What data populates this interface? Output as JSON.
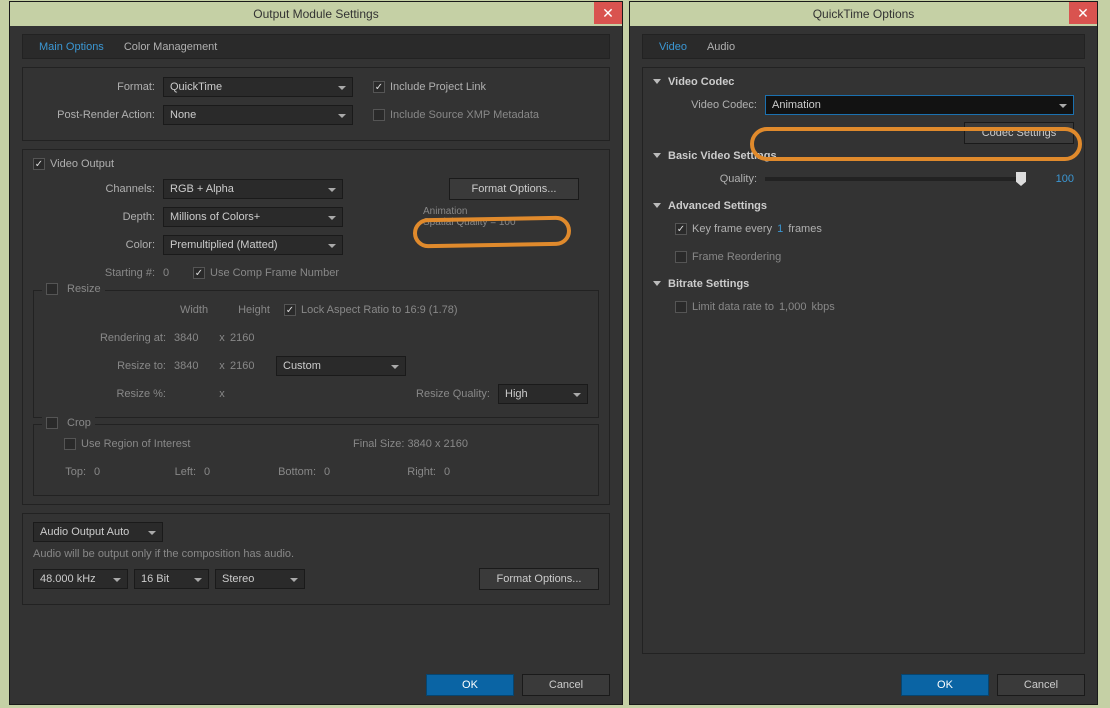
{
  "win1": {
    "title": "Output Module Settings",
    "tabs": {
      "main": "Main Options",
      "color": "Color Management"
    },
    "format": {
      "label": "Format:",
      "value": "QuickTime"
    },
    "include_project_link": "Include Project Link",
    "post_render": {
      "label": "Post-Render Action:",
      "value": "None"
    },
    "include_xmp": "Include Source XMP Metadata",
    "video_output": "Video Output",
    "channels": {
      "label": "Channels:",
      "value": "RGB + Alpha"
    },
    "depth": {
      "label": "Depth:",
      "value": "Millions of Colors+"
    },
    "color": {
      "label": "Color:",
      "value": "Premultiplied (Matted)"
    },
    "starting": {
      "label": "Starting #:",
      "value": "0"
    },
    "use_comp_frame": "Use Comp Frame Number",
    "format_options": "Format Options...",
    "codec_line1": "Animation",
    "codec_line2": "Spatial Quality = 100",
    "resize": {
      "legend": "Resize",
      "width": "Width",
      "height": "Height",
      "lock_aspect": "Lock Aspect Ratio to 16:9 (1.78)",
      "rendering_at": "Rendering at:",
      "rw": "3840",
      "rx": "x",
      "rh": "2160",
      "resize_to": "Resize to:",
      "tw": "3840",
      "th": "2160",
      "custom": "Custom",
      "resize_pct": "Resize %:",
      "resize_quality": "Resize Quality:",
      "rq_val": "High"
    },
    "crop": {
      "legend": "Crop",
      "use_roi": "Use Region of Interest",
      "final_size": "Final Size: 3840 x 2160",
      "top": "Top:",
      "left": "Left:",
      "bottom": "Bottom:",
      "right": "Right:",
      "zero": "0"
    },
    "audio": {
      "output": "Audio Output Auto",
      "hint": "Audio will be output only if the composition has audio.",
      "rate": "48.000 kHz",
      "depth": "16 Bit",
      "ch": "Stereo",
      "format_options": "Format Options..."
    },
    "ok": "OK",
    "cancel": "Cancel"
  },
  "win2": {
    "title": "QuickTime Options",
    "tabs": {
      "video": "Video",
      "audio": "Audio"
    },
    "video_codec_section": "Video Codec",
    "video_codec_label": "Video Codec:",
    "video_codec_value": "Animation",
    "codec_settings": "Codec Settings",
    "basic_section": "Basic Video Settings",
    "quality": "Quality:",
    "quality_val": "100",
    "adv_section": "Advanced Settings",
    "key_frame": "Key frame every",
    "key_frame_val": "1",
    "frames_suffix": "frames",
    "frame_reorder": "Frame Reordering",
    "bitrate_section": "Bitrate Settings",
    "limit_rate": "Limit data rate to",
    "bitrate_val": "1,000",
    "kbps": "kbps",
    "ok": "OK",
    "cancel": "Cancel"
  }
}
